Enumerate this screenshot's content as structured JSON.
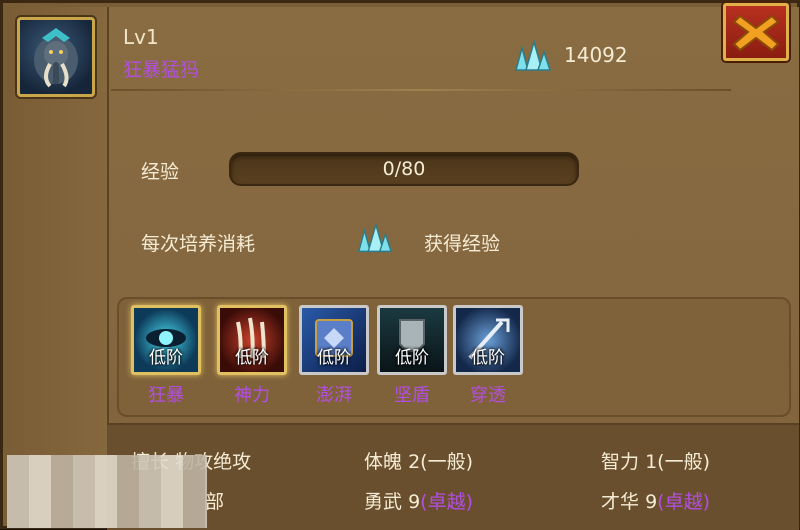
{
  "header": {
    "level": "Lv1",
    "name": "狂暴猛犸",
    "currency_amount": "14092",
    "currency_icon": "blue-crystal-icon",
    "close_icon": "close-x-icon"
  },
  "experience": {
    "label": "经验",
    "value_text": "0/80",
    "current": 0,
    "max": 80
  },
  "cultivation": {
    "cost_label": "每次培养消耗",
    "cost_icon": "blue-crystal-icon",
    "gain_label": "获得经验"
  },
  "skills": [
    {
      "name": "狂暴",
      "tier": "低阶",
      "icon": "beast-eye-icon"
    },
    {
      "name": "神力",
      "tier": "低阶",
      "icon": "claw-icon"
    },
    {
      "name": "澎湃",
      "tier": "低阶",
      "icon": "spell-book-icon"
    },
    {
      "name": "坚盾",
      "tier": "低阶",
      "icon": "shield-icon"
    },
    {
      "name": "穿透",
      "tier": "低阶",
      "icon": "pierce-sword-icon"
    }
  ],
  "stats": {
    "specialty_label": "擅长",
    "specialty_value": "物攻绝攻",
    "row2_partial": "部",
    "physique_label": "体魄",
    "physique_value": "2",
    "physique_grade": "(一般)",
    "valor_label": "勇武",
    "valor_value": "9",
    "valor_grade": "(卓越)",
    "intellect_label": "智力",
    "intellect_value": "1",
    "intellect_grade": "(一般)",
    "talent_label": "才华",
    "talent_value": "9",
    "talent_grade": "(卓越)"
  },
  "colors": {
    "panel": "#856740",
    "accent_purple": "#b24fe0",
    "text": "#f5ecd5",
    "close_red": "#b83020"
  }
}
